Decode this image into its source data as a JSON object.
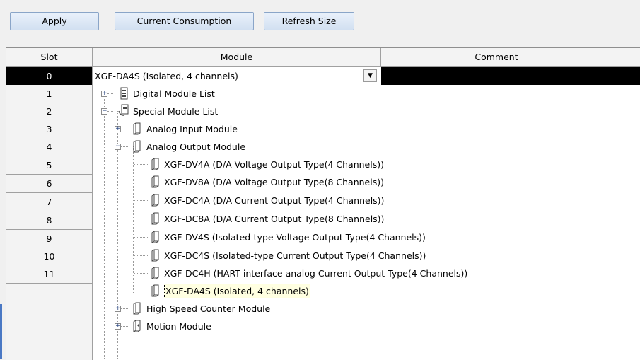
{
  "toolbar": {
    "apply_label": "Apply",
    "current_consumption_label": "Current Consumption",
    "refresh_size_label": "Refresh Size"
  },
  "table": {
    "headers": {
      "slot": "Slot",
      "module": "Module",
      "comment": "Comment"
    },
    "slots": [
      "0",
      "1",
      "2",
      "3",
      "4",
      "5",
      "6",
      "7",
      "8",
      "9",
      "10",
      "11"
    ],
    "selected_slot": "0",
    "row0_module_value": "XGF-DA4S (Isolated, 4 channels)"
  },
  "tree": {
    "digital_module_list": "Digital Module List",
    "special_module_list": "Special Module List",
    "analog_input_module": "Analog Input Module",
    "analog_output_module": "Analog Output Module",
    "analog_output_items": [
      "XGF-DV4A (D/A Voltage Output Type(4 Channels))",
      "XGF-DV8A (D/A Voltage Output Type(8 Channels))",
      "XGF-DC4A (D/A Current Output Type(4 Channels))",
      "XGF-DC8A (D/A Current Output Type(8 Channels))",
      "XGF-DV4S (Isolated-type Voltage Output Type(4 Channels))",
      "XGF-DC4S (Isolated-type Current Output Type(4 Channels))",
      "XGF-DC4H (HART interface analog Current Output Type(4 Channels))",
      "XGF-DA4S (Isolated, 4 channels)"
    ],
    "selected_item": "XGF-DA4S (Isolated, 4 channels)",
    "high_speed_counter_module": "High Speed Counter Module",
    "motion_module": "Motion Module"
  },
  "colors": {
    "selection_black": "#000000",
    "highlight_bg": "#ffffe1",
    "button_border": "#8aa5c8"
  }
}
